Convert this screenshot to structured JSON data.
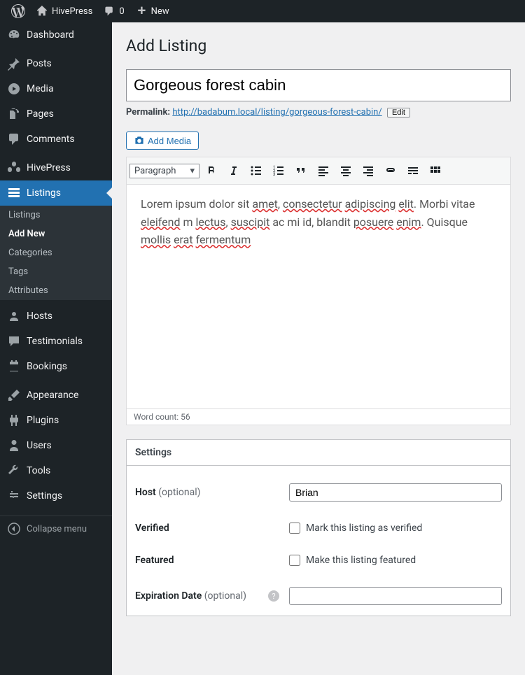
{
  "adminbar": {
    "site_name": "HivePress",
    "comments_count": "0",
    "new_label": "New"
  },
  "sidebar": {
    "items": [
      {
        "label": "Dashboard"
      },
      {
        "label": "Posts"
      },
      {
        "label": "Media"
      },
      {
        "label": "Pages"
      },
      {
        "label": "Comments"
      },
      {
        "label": "HivePress"
      },
      {
        "label": "Listings"
      },
      {
        "label": "Hosts"
      },
      {
        "label": "Testimonials"
      },
      {
        "label": "Bookings"
      },
      {
        "label": "Appearance"
      },
      {
        "label": "Plugins"
      },
      {
        "label": "Users"
      },
      {
        "label": "Tools"
      },
      {
        "label": "Settings"
      }
    ],
    "submenu": [
      {
        "label": "Listings"
      },
      {
        "label": "Add New"
      },
      {
        "label": "Categories"
      },
      {
        "label": "Tags"
      },
      {
        "label": "Attributes"
      }
    ],
    "collapse_label": "Collapse menu"
  },
  "page": {
    "title": "Add Listing",
    "listing_title": "Gorgeous forest cabin",
    "permalink_label": "Permalink:",
    "permalink_base": "http://badabum.local/listing/",
    "permalink_slug": "gorgeous-forest-cabin/",
    "edit_button": "Edit",
    "add_media": "Add Media",
    "format_select": "Paragraph",
    "editor_text_plain_parts": [
      "Lorem ipsum dolor sit ",
      "amet",
      ", ",
      "consectetur",
      " ",
      "adipiscing",
      " ",
      "elit",
      ". Morbi vitae ",
      "eleifend",
      " m",
      " ",
      "lectus",
      ", ",
      "suscipit",
      " ac mi id, blandit ",
      "posuere",
      " ",
      "enim",
      ". Quisque ",
      "mollis",
      " ",
      "erat",
      " ",
      "fermentum"
    ],
    "word_count_label": "Word count: 56",
    "settings_title": "Settings",
    "fields": {
      "host": {
        "label": "Host",
        "optional": "(optional)",
        "value": "Brian"
      },
      "verified": {
        "label": "Verified",
        "checkbox_label": "Mark this listing as verified"
      },
      "featured": {
        "label": "Featured",
        "checkbox_label": "Make this listing featured"
      },
      "expiration": {
        "label": "Expiration Date",
        "optional": "(optional)",
        "value": ""
      }
    }
  }
}
